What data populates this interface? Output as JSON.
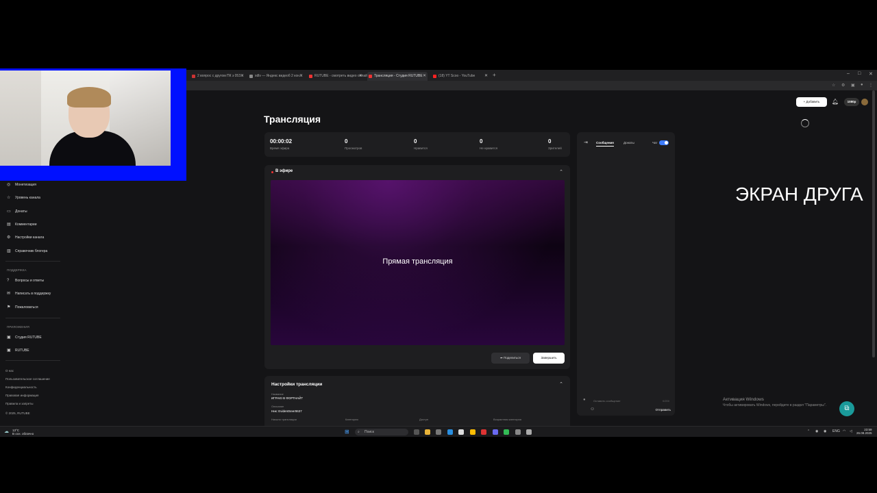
{
  "browser": {
    "tabs": [
      {
        "label": "2 вопрос с другом ПК з 05З..."
      },
      {
        "label": "xdlv — Яндекс видеоб 2 кон..."
      },
      {
        "label": "RUTUBE - смотреть видео онлай..."
      },
      {
        "label": "Трансляция - Студия RUTUBE"
      },
      {
        "label": "(18) YT Scoo - YouTube"
      }
    ],
    "new_tab": "+"
  },
  "sidebar": {
    "items": [
      {
        "label": "Монетизация",
        "icon": "coin-icon"
      },
      {
        "label": "Уровень канала",
        "icon": "star-icon"
      },
      {
        "label": "Донаты",
        "icon": "wallet-icon"
      },
      {
        "label": "Комментарии",
        "icon": "comment-icon"
      },
      {
        "label": "Настройки канала",
        "icon": "gear-icon"
      },
      {
        "label": "Справочник блогера",
        "icon": "book-icon"
      }
    ],
    "support_heading": "Поддержка",
    "support_items": [
      {
        "label": "Вопросы и ответы",
        "icon": "question-icon"
      },
      {
        "label": "Написать в поддержку",
        "icon": "mail-icon"
      },
      {
        "label": "Пожаловаться",
        "icon": "flag-icon"
      }
    ],
    "apps_heading": "Приложения",
    "apps_items": [
      {
        "label": "Студия RUTUBE",
        "icon": "studio-icon"
      },
      {
        "label": "RUTUBE",
        "icon": "rutube-icon"
      }
    ],
    "footer": [
      "О нас",
      "Пользовательское соглашение",
      "Конфиденциальность",
      "Правовая информация",
      "Правила и запреты",
      "© 2025, RUTUBE"
    ]
  },
  "page": {
    "title": "Трансляция"
  },
  "stats": [
    {
      "value": "00:00:02",
      "label": "Время эфира"
    },
    {
      "value": "0",
      "label": "Просмотров"
    },
    {
      "value": "0",
      "label": "Нравится"
    },
    {
      "value": "0",
      "label": "Не нравится"
    },
    {
      "value": "0",
      "label": "Зрителей"
    }
  ],
  "live": {
    "label": "В эфире",
    "video_text": "Прямая трансляция",
    "share_label": "Поделиться",
    "finish_label": "Завершить"
  },
  "settings": {
    "title": "Настройки трансляции",
    "name_label": "Название",
    "name_value": "ИГРАЮ В ФОРТНАЙТ",
    "desc_label": "Описание",
    "desc_value": "Ник: EvidentSeer8637",
    "start_label": "Начало трансляции",
    "category_label": "Категория",
    "access_label": "Доступ",
    "age_label": "Возрастная категория"
  },
  "chat": {
    "tabs": [
      "Сообщения",
      "Донаты"
    ],
    "chat_toggle_label": "Чат",
    "input_placeholder": "Оставить сообщение",
    "counter": "0/200",
    "send_label": "Отправить"
  },
  "topbar": {
    "add_label": "Добавить",
    "quality": "1080p"
  },
  "overlay": {
    "friend_screen": "ЭКРАН ДРУГА",
    "activate_title": "Активация Windows",
    "activate_sub": "Чтобы активировать Windows, перейдите в раздел \"Параметры\"."
  },
  "taskbar": {
    "weather_temp": "13°C",
    "weather_desc": "В осн. облачно",
    "search_placeholder": "Поиск",
    "lang": "ENG",
    "time": "23:59",
    "date": "26.08.2025"
  },
  "colors": {
    "accent": "#3d7cff",
    "live": "#e33333",
    "webcam_border": "#0010ff"
  }
}
